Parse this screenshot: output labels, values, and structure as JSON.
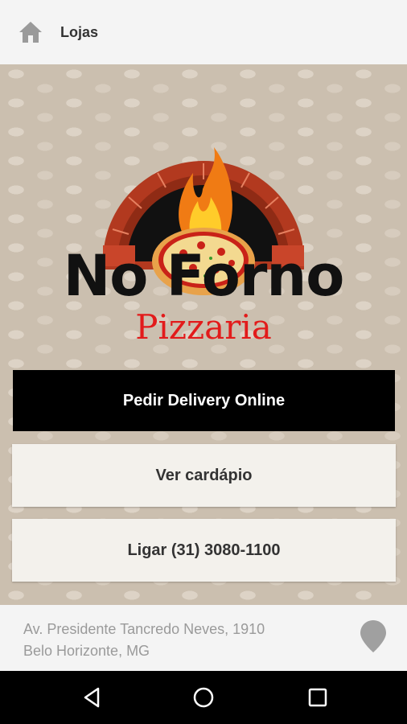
{
  "appbar": {
    "title": "Lojas",
    "home_icon": "home-icon"
  },
  "brand": {
    "name": "No Forno",
    "subtitle": "Pizzaria"
  },
  "buttons": {
    "delivery": "Pedir Delivery Online",
    "menu": "Ver cardápio",
    "call": "Ligar (31) 3080-1100"
  },
  "footer": {
    "address_line1": "Av. Presidente Tancredo Neves, 1910",
    "address_line2": "Belo Horizonte, MG",
    "map_icon": "map-pin-icon"
  },
  "navbar": {
    "back_icon": "back-icon",
    "home_icon": "home-circle-icon",
    "recents_icon": "recents-icon"
  },
  "colors": {
    "brand_red": "#e21b1b",
    "primary_button": "#000000",
    "accent_gray": "#9a9a9a"
  }
}
